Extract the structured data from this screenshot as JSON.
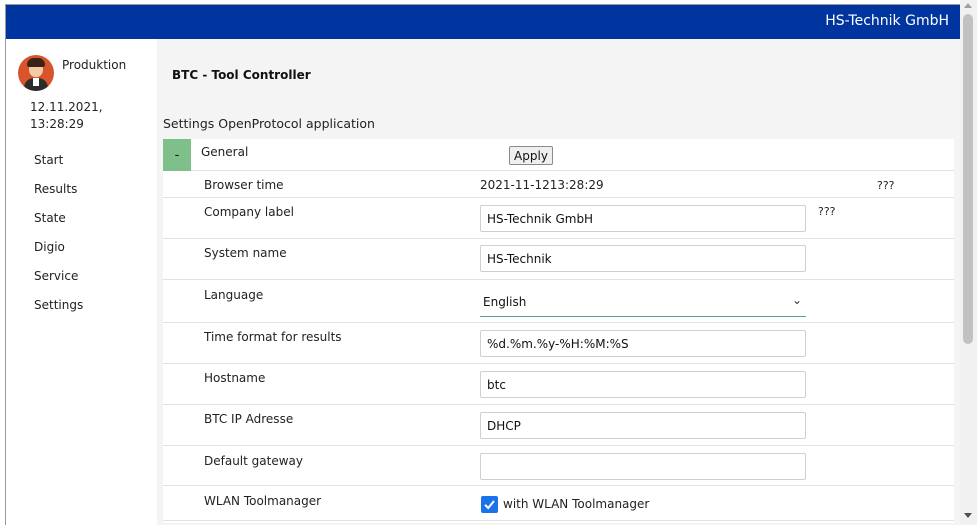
{
  "header": {
    "brand": "HS-Technik GmbH"
  },
  "sidebar": {
    "user": "Produktion",
    "date": "12.11.2021,",
    "time": "13:28:29",
    "items": [
      {
        "label": "Start"
      },
      {
        "label": "Results"
      },
      {
        "label": "State"
      },
      {
        "label": "Digio"
      },
      {
        "label": "Service"
      },
      {
        "label": "Settings"
      }
    ]
  },
  "main": {
    "app_title": "BTC - Tool Controller",
    "section_title": "Settings OpenProtocol application",
    "panel": {
      "collapse_symbol": "-",
      "title": "General",
      "apply_label": "Apply"
    },
    "fields": {
      "browser_time": {
        "label": "Browser time",
        "value": "2021-11-1213:28:29",
        "note": "???"
      },
      "company_label": {
        "label": "Company label",
        "value": "HS-Technik GmbH",
        "note": "???"
      },
      "system_name": {
        "label": "System name",
        "value": "HS-Technik"
      },
      "language": {
        "label": "Language",
        "value": "English"
      },
      "time_format": {
        "label": "Time format for results",
        "value": "%d.%m.%y-%H:%M:%S"
      },
      "hostname": {
        "label": "Hostname",
        "value": "btc"
      },
      "btc_ip": {
        "label": "BTC IP Adresse",
        "value": "DHCP"
      },
      "default_gateway": {
        "label": "Default gateway",
        "value": ""
      },
      "wlan_toolmanager": {
        "label": "WLAN Toolmanager",
        "checkbox_label": "with WLAN Toolmanager",
        "checked": true
      }
    }
  },
  "colors": {
    "topbar": "#0035a0",
    "collapse_button": "#7fbf8a",
    "checkbox": "#1a73e8",
    "select_underline": "#5a9e9a"
  }
}
